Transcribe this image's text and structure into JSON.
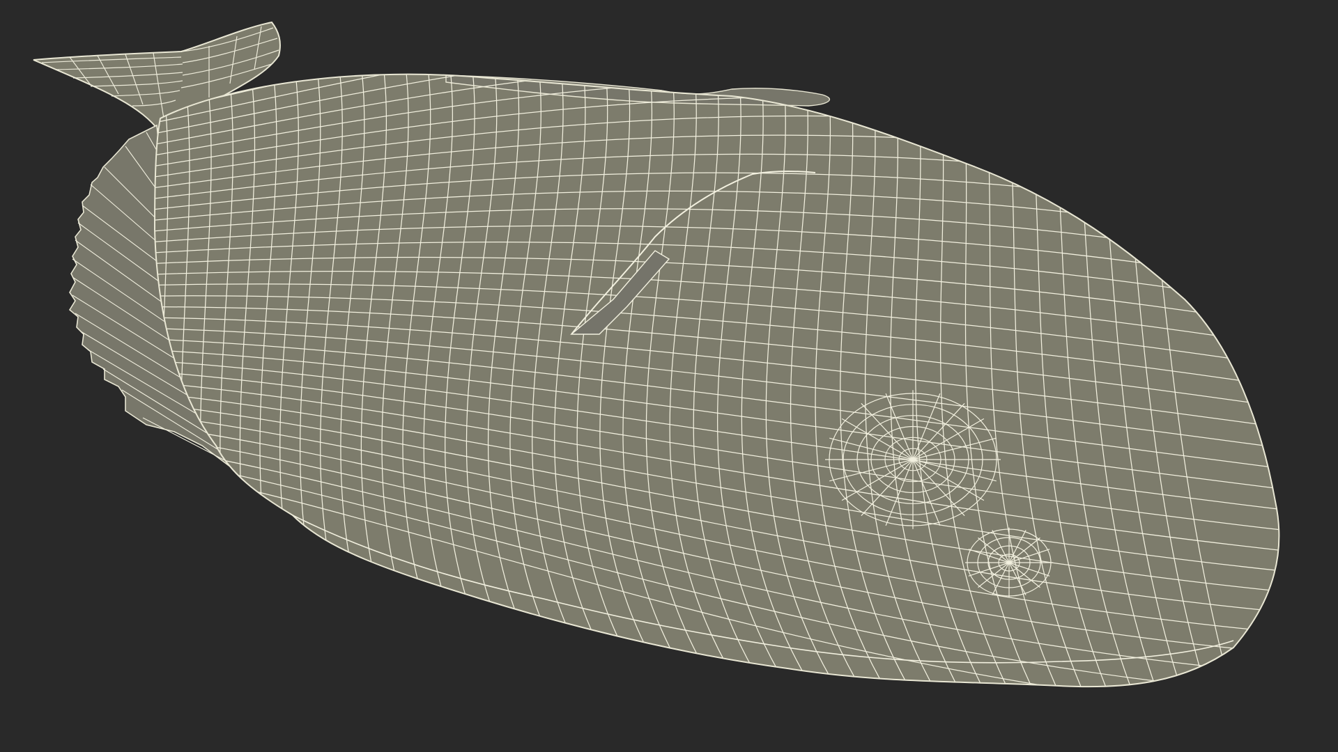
{
  "scene": {
    "subject": "wireframe-fish-model",
    "colors": {
      "background": "#292929",
      "surface_fill": "#7d7c6c",
      "surface_fill_shadow": "#6f6e5f",
      "wire": "#f2f0df",
      "outline": "#e9e7d4"
    },
    "icons": [
      "fish-mesh"
    ]
  }
}
